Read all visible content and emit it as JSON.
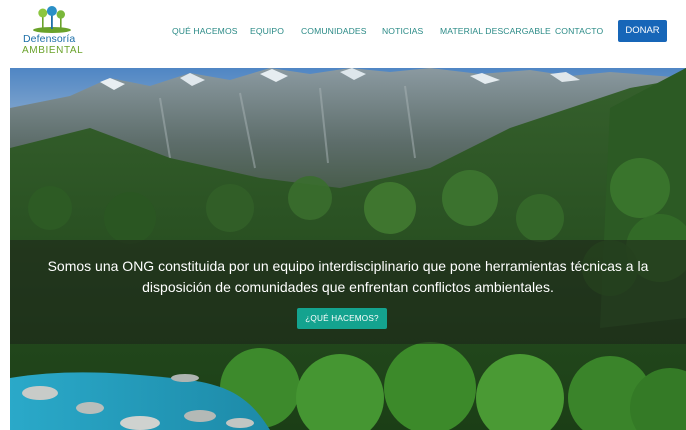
{
  "logo": {
    "line1": "Defensoría",
    "line2": "AMBIENTAL"
  },
  "nav": {
    "items": [
      {
        "label": "QUÉ HACEMOS"
      },
      {
        "label": "EQUIPO"
      },
      {
        "label": "COMUNIDADES"
      },
      {
        "label": "NOTICIAS"
      },
      {
        "label": "MATERIAL DESCARGABLE"
      },
      {
        "label": "CONTACTO"
      }
    ],
    "donate_label": "DONAR"
  },
  "hero": {
    "text": "Somos una ONG constituida por un equipo interdisciplinario que pone herramientas técnicas a la disposición de comunidades que enfrentan conflictos ambientales.",
    "button_label": "¿QUÉ HACEMOS?"
  },
  "colors": {
    "nav_text": "#2a8a86",
    "donate_bg": "#1766b8",
    "hero_button_bg": "#14a38f",
    "logo_blue": "#1d6fa8",
    "logo_green": "#6aa22a"
  }
}
